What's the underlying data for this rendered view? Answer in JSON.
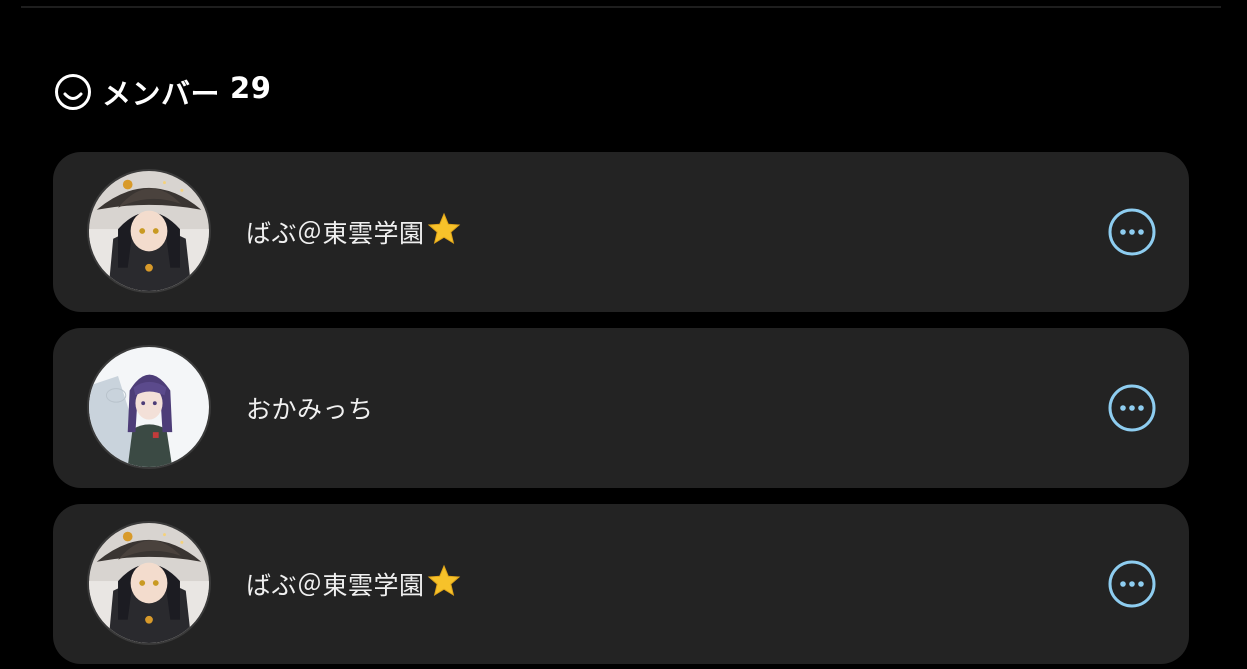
{
  "section": {
    "icon": "smile-icon",
    "title": "メンバー",
    "count": "29"
  },
  "members": [
    {
      "name": "ばぶ＠東雲学園",
      "badge_icon": "star-icon",
      "avatar": "witch-girl-avatar"
    },
    {
      "name": "おかみっち",
      "badge_icon": "",
      "avatar": "purple-hair-girl-avatar"
    },
    {
      "name": "ばぶ＠東雲学園",
      "badge_icon": "star-icon",
      "avatar": "witch-girl-avatar"
    }
  ],
  "colors": {
    "background": "#000000",
    "card": "#232323",
    "accent": "#8ecdf0",
    "star": "#f7c22a"
  }
}
